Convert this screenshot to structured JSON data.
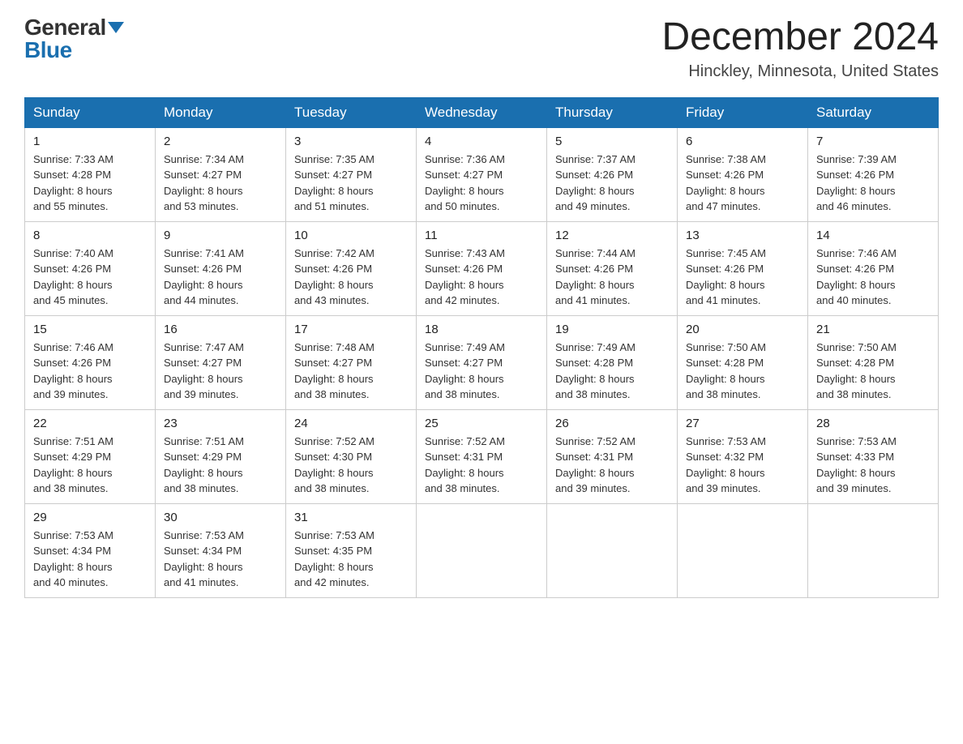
{
  "header": {
    "logo_general": "General",
    "logo_blue": "Blue",
    "month_title": "December 2024",
    "location": "Hinckley, Minnesota, United States"
  },
  "days_of_week": [
    "Sunday",
    "Monday",
    "Tuesday",
    "Wednesday",
    "Thursday",
    "Friday",
    "Saturday"
  ],
  "weeks": [
    [
      {
        "day": "1",
        "sunrise": "7:33 AM",
        "sunset": "4:28 PM",
        "daylight": "8 hours and 55 minutes."
      },
      {
        "day": "2",
        "sunrise": "7:34 AM",
        "sunset": "4:27 PM",
        "daylight": "8 hours and 53 minutes."
      },
      {
        "day": "3",
        "sunrise": "7:35 AM",
        "sunset": "4:27 PM",
        "daylight": "8 hours and 51 minutes."
      },
      {
        "day": "4",
        "sunrise": "7:36 AM",
        "sunset": "4:27 PM",
        "daylight": "8 hours and 50 minutes."
      },
      {
        "day": "5",
        "sunrise": "7:37 AM",
        "sunset": "4:26 PM",
        "daylight": "8 hours and 49 minutes."
      },
      {
        "day": "6",
        "sunrise": "7:38 AM",
        "sunset": "4:26 PM",
        "daylight": "8 hours and 47 minutes."
      },
      {
        "day": "7",
        "sunrise": "7:39 AM",
        "sunset": "4:26 PM",
        "daylight": "8 hours and 46 minutes."
      }
    ],
    [
      {
        "day": "8",
        "sunrise": "7:40 AM",
        "sunset": "4:26 PM",
        "daylight": "8 hours and 45 minutes."
      },
      {
        "day": "9",
        "sunrise": "7:41 AM",
        "sunset": "4:26 PM",
        "daylight": "8 hours and 44 minutes."
      },
      {
        "day": "10",
        "sunrise": "7:42 AM",
        "sunset": "4:26 PM",
        "daylight": "8 hours and 43 minutes."
      },
      {
        "day": "11",
        "sunrise": "7:43 AM",
        "sunset": "4:26 PM",
        "daylight": "8 hours and 42 minutes."
      },
      {
        "day": "12",
        "sunrise": "7:44 AM",
        "sunset": "4:26 PM",
        "daylight": "8 hours and 41 minutes."
      },
      {
        "day": "13",
        "sunrise": "7:45 AM",
        "sunset": "4:26 PM",
        "daylight": "8 hours and 41 minutes."
      },
      {
        "day": "14",
        "sunrise": "7:46 AM",
        "sunset": "4:26 PM",
        "daylight": "8 hours and 40 minutes."
      }
    ],
    [
      {
        "day": "15",
        "sunrise": "7:46 AM",
        "sunset": "4:26 PM",
        "daylight": "8 hours and 39 minutes."
      },
      {
        "day": "16",
        "sunrise": "7:47 AM",
        "sunset": "4:27 PM",
        "daylight": "8 hours and 39 minutes."
      },
      {
        "day": "17",
        "sunrise": "7:48 AM",
        "sunset": "4:27 PM",
        "daylight": "8 hours and 38 minutes."
      },
      {
        "day": "18",
        "sunrise": "7:49 AM",
        "sunset": "4:27 PM",
        "daylight": "8 hours and 38 minutes."
      },
      {
        "day": "19",
        "sunrise": "7:49 AM",
        "sunset": "4:28 PM",
        "daylight": "8 hours and 38 minutes."
      },
      {
        "day": "20",
        "sunrise": "7:50 AM",
        "sunset": "4:28 PM",
        "daylight": "8 hours and 38 minutes."
      },
      {
        "day": "21",
        "sunrise": "7:50 AM",
        "sunset": "4:28 PM",
        "daylight": "8 hours and 38 minutes."
      }
    ],
    [
      {
        "day": "22",
        "sunrise": "7:51 AM",
        "sunset": "4:29 PM",
        "daylight": "8 hours and 38 minutes."
      },
      {
        "day": "23",
        "sunrise": "7:51 AM",
        "sunset": "4:29 PM",
        "daylight": "8 hours and 38 minutes."
      },
      {
        "day": "24",
        "sunrise": "7:52 AM",
        "sunset": "4:30 PM",
        "daylight": "8 hours and 38 minutes."
      },
      {
        "day": "25",
        "sunrise": "7:52 AM",
        "sunset": "4:31 PM",
        "daylight": "8 hours and 38 minutes."
      },
      {
        "day": "26",
        "sunrise": "7:52 AM",
        "sunset": "4:31 PM",
        "daylight": "8 hours and 39 minutes."
      },
      {
        "day": "27",
        "sunrise": "7:53 AM",
        "sunset": "4:32 PM",
        "daylight": "8 hours and 39 minutes."
      },
      {
        "day": "28",
        "sunrise": "7:53 AM",
        "sunset": "4:33 PM",
        "daylight": "8 hours and 39 minutes."
      }
    ],
    [
      {
        "day": "29",
        "sunrise": "7:53 AM",
        "sunset": "4:34 PM",
        "daylight": "8 hours and 40 minutes."
      },
      {
        "day": "30",
        "sunrise": "7:53 AM",
        "sunset": "4:34 PM",
        "daylight": "8 hours and 41 minutes."
      },
      {
        "day": "31",
        "sunrise": "7:53 AM",
        "sunset": "4:35 PM",
        "daylight": "8 hours and 42 minutes."
      },
      null,
      null,
      null,
      null
    ]
  ],
  "labels": {
    "sunrise": "Sunrise:",
    "sunset": "Sunset:",
    "daylight": "Daylight:"
  }
}
